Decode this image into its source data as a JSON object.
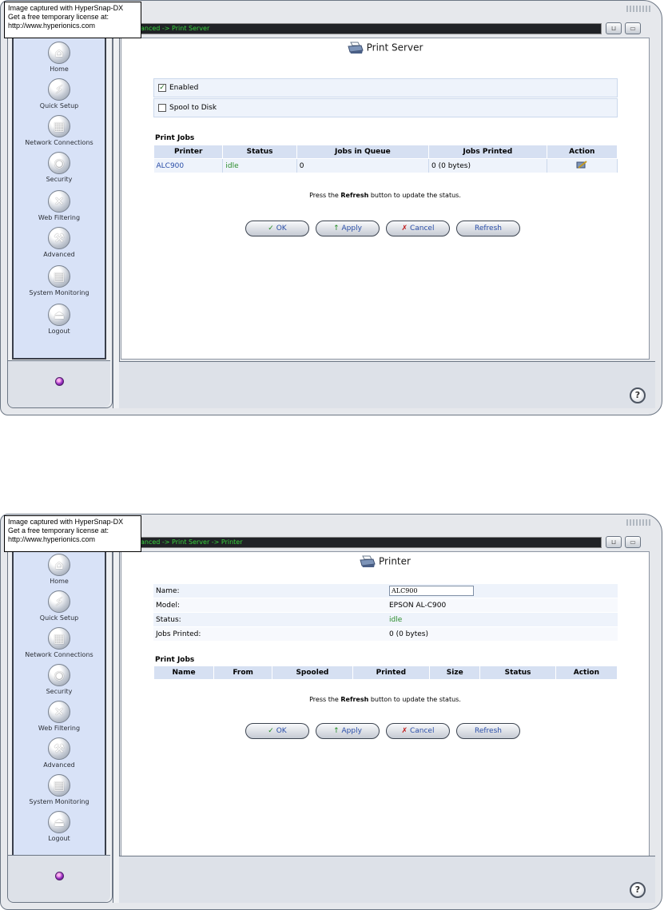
{
  "watermark": {
    "line1": "Image captured with HyperSnap-DX",
    "line2": "Get a free temporary license at:",
    "line3": "http://www.hyperionics.com"
  },
  "sidebar": {
    "items": [
      {
        "label": "Home",
        "icon": "home-icon"
      },
      {
        "label": "Quick Setup",
        "icon": "lightning-icon"
      },
      {
        "label": "Network Connections",
        "icon": "network-icon"
      },
      {
        "label": "Security",
        "icon": "security-icon"
      },
      {
        "label": "Web Filtering",
        "icon": "web-filter-icon"
      },
      {
        "label": "Advanced",
        "icon": "tools-icon"
      },
      {
        "label": "System Monitoring",
        "icon": "monitor-icon"
      },
      {
        "label": "Logout",
        "icon": "logout-icon"
      }
    ]
  },
  "buttons": {
    "ok": "OK",
    "ok_symbol": "✓",
    "apply": "Apply",
    "apply_symbol": "↑",
    "cancel": "Cancel",
    "cancel_symbol": "✗",
    "refresh": "Refresh"
  },
  "note": {
    "prefix": "Press the ",
    "bold": "Refresh",
    "suffix": " button to update the status."
  },
  "screen1": {
    "breadcrumb": "anced -> Print Server",
    "title": "Print Server",
    "enabled_label": "Enabled",
    "enabled_checked": "✓",
    "spool_label": "Spool to Disk",
    "section": "Print Jobs",
    "columns": [
      "Printer",
      "Status",
      "Jobs in Queue",
      "Jobs Printed",
      "Action"
    ],
    "rows": [
      {
        "printer": "ALC900",
        "status": "idle",
        "jobs_in_queue": "0",
        "jobs_printed": "0 (0 bytes)"
      }
    ]
  },
  "screen2": {
    "breadcrumb": "anced -> Print Server -> Printer",
    "title": "Printer",
    "fields": {
      "name_label": "Name:",
      "name_value": "ALC900",
      "model_label": "Model:",
      "model_value": "EPSON AL-C900",
      "status_label": "Status:",
      "status_value": "idle",
      "jobs_label": "Jobs Printed:",
      "jobs_value": "0 (0 bytes)"
    },
    "section": "Print Jobs",
    "columns": [
      "Name",
      "From",
      "Spooled",
      "Printed",
      "Size",
      "Status",
      "Action"
    ]
  },
  "colors": {
    "breadcrumb": "#36d43c",
    "link": "#2a4ea8",
    "idle": "#2a8c2a",
    "sidebar": "#d8e2f7"
  }
}
